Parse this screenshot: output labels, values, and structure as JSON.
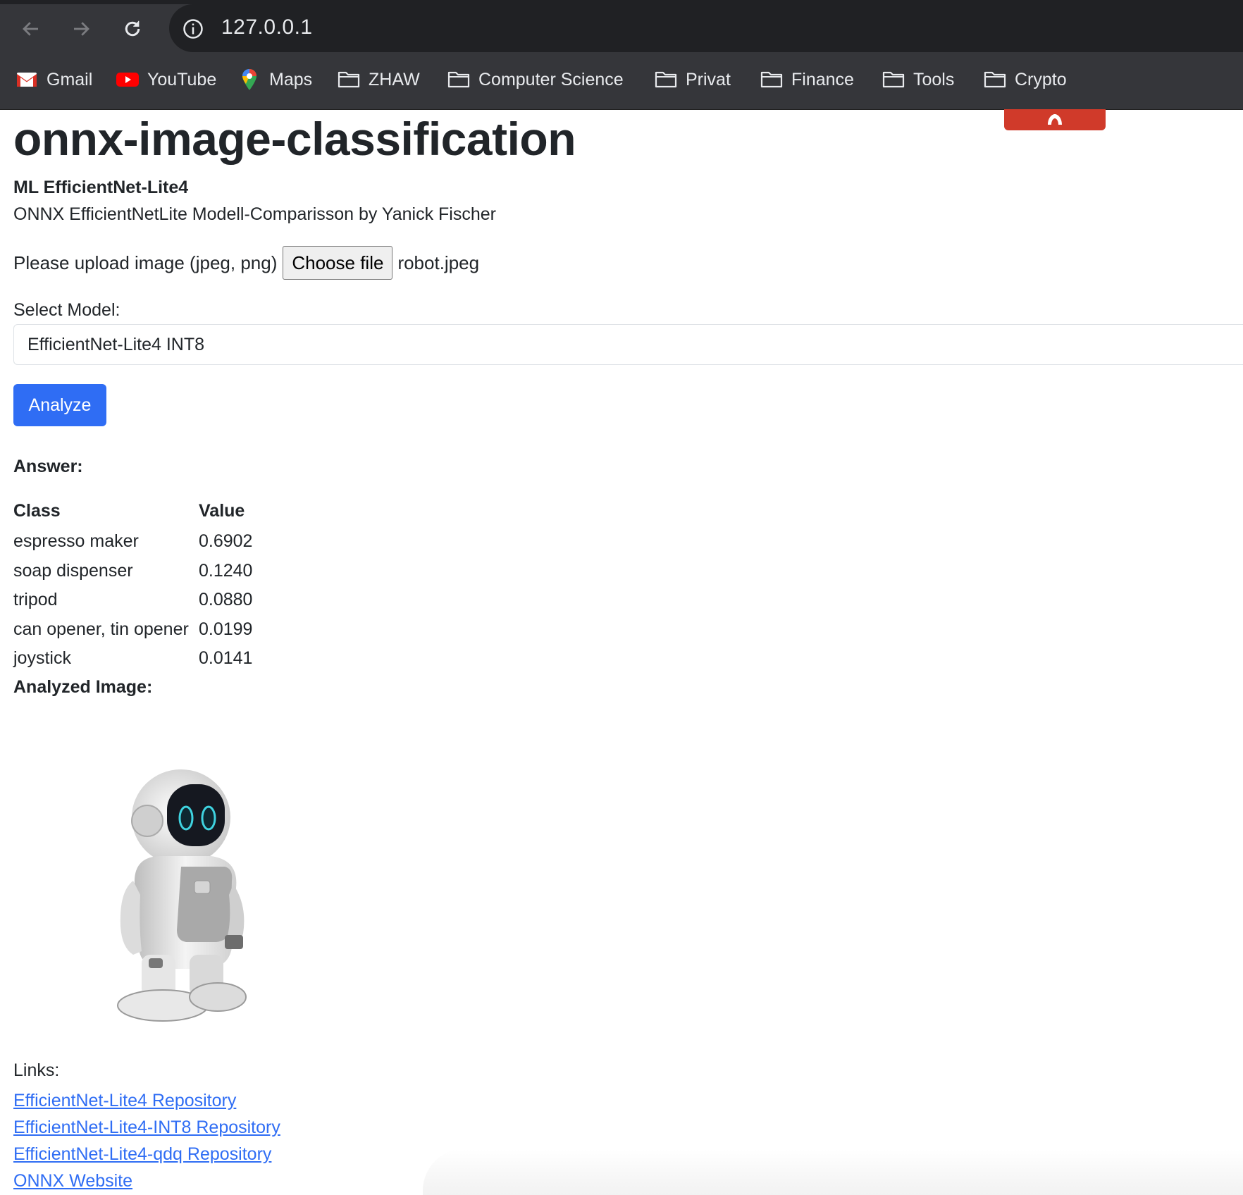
{
  "browser": {
    "url": "127.0.0.1",
    "bookmarks": [
      {
        "label": "Gmail",
        "icon": "gmail-icon"
      },
      {
        "label": "YouTube",
        "icon": "youtube-icon"
      },
      {
        "label": "Maps",
        "icon": "maps-icon"
      },
      {
        "label": "ZHAW",
        "icon": "folder-icon"
      },
      {
        "label": "Computer Science",
        "icon": "folder-icon"
      },
      {
        "label": "Privat",
        "icon": "folder-icon"
      },
      {
        "label": "Finance",
        "icon": "folder-icon"
      },
      {
        "label": "Tools",
        "icon": "folder-icon"
      },
      {
        "label": "Crypto",
        "icon": "folder-icon"
      }
    ]
  },
  "page": {
    "title": "onnx-image-classification",
    "subtitle_strong": "ML EfficientNet-Lite4",
    "subtitle": "ONNX EfficientNetLite Modell-Comparisson by Yanick Fischer",
    "upload_label": "Please upload image (jpeg, png)",
    "choose_file_label": "Choose file",
    "file_name": "robot.jpeg",
    "select_label": "Select Model:",
    "selected_model": "EfficientNet-Lite4 INT8",
    "analyze_label": "Analyze",
    "answer_label": "Answer:",
    "table": {
      "headers": [
        "Class",
        "Value"
      ],
      "rows": [
        [
          "espresso maker",
          "0.6902"
        ],
        [
          "soap dispenser",
          "0.1240"
        ],
        [
          "tripod",
          "0.0880"
        ],
        [
          "can opener, tin opener",
          "0.0199"
        ],
        [
          "joystick",
          "0.0141"
        ]
      ]
    },
    "analyzed_image_label": "Analyzed Image:",
    "links_label": "Links:",
    "links": [
      "EfficientNet-Lite4 Repository",
      "EfficientNet-Lite4-INT8 Repository",
      "EfficientNet-Lite4-qdq Repository",
      "ONNX Website"
    ]
  },
  "colors": {
    "accent": "#2f6df4",
    "chrome_bg": "#35363a",
    "omnibox_bg": "#202124",
    "red_tab": "#d03a2a"
  }
}
